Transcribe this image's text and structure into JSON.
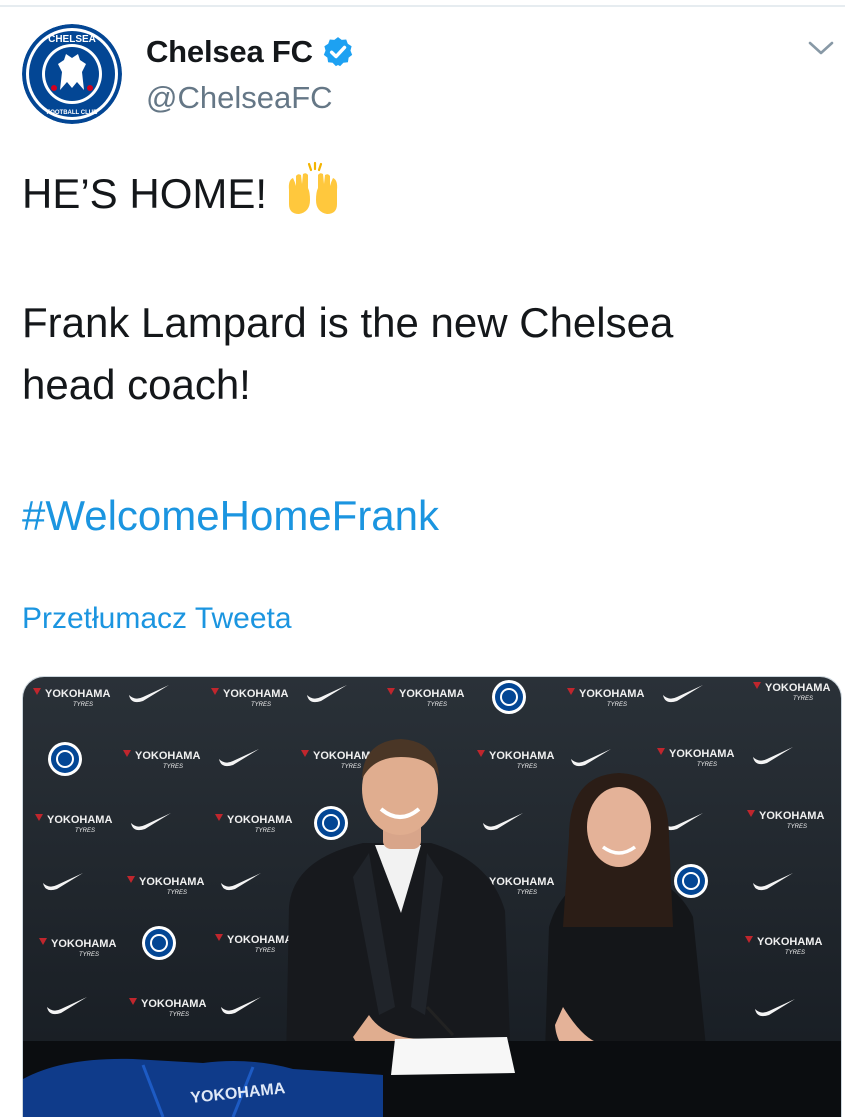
{
  "tweet": {
    "author": {
      "name": "Chelsea FC",
      "handle": "@ChelseaFC",
      "verified": true,
      "avatar_icon": "chelsea-crest-icon"
    },
    "text_line1": "HE’S HOME!",
    "emoji_icon": "raising-hands-icon",
    "text_line2a": "Frank Lampard is the new Chelsea",
    "text_line2b": "head coach!",
    "hashtag": "#WelcomeHomeFrank",
    "translate_label": "Przetłumacz Tweeta",
    "menu_icon": "chevron-down-icon",
    "media": {
      "backdrop_brand": "YOKOHAMA",
      "backdrop_sub": "TYRES"
    }
  },
  "colors": {
    "link": "#1b95e0",
    "text": "#14171a",
    "handle": "#657786",
    "chelsea_blue": "#034694",
    "verified": "#1da1f2"
  }
}
